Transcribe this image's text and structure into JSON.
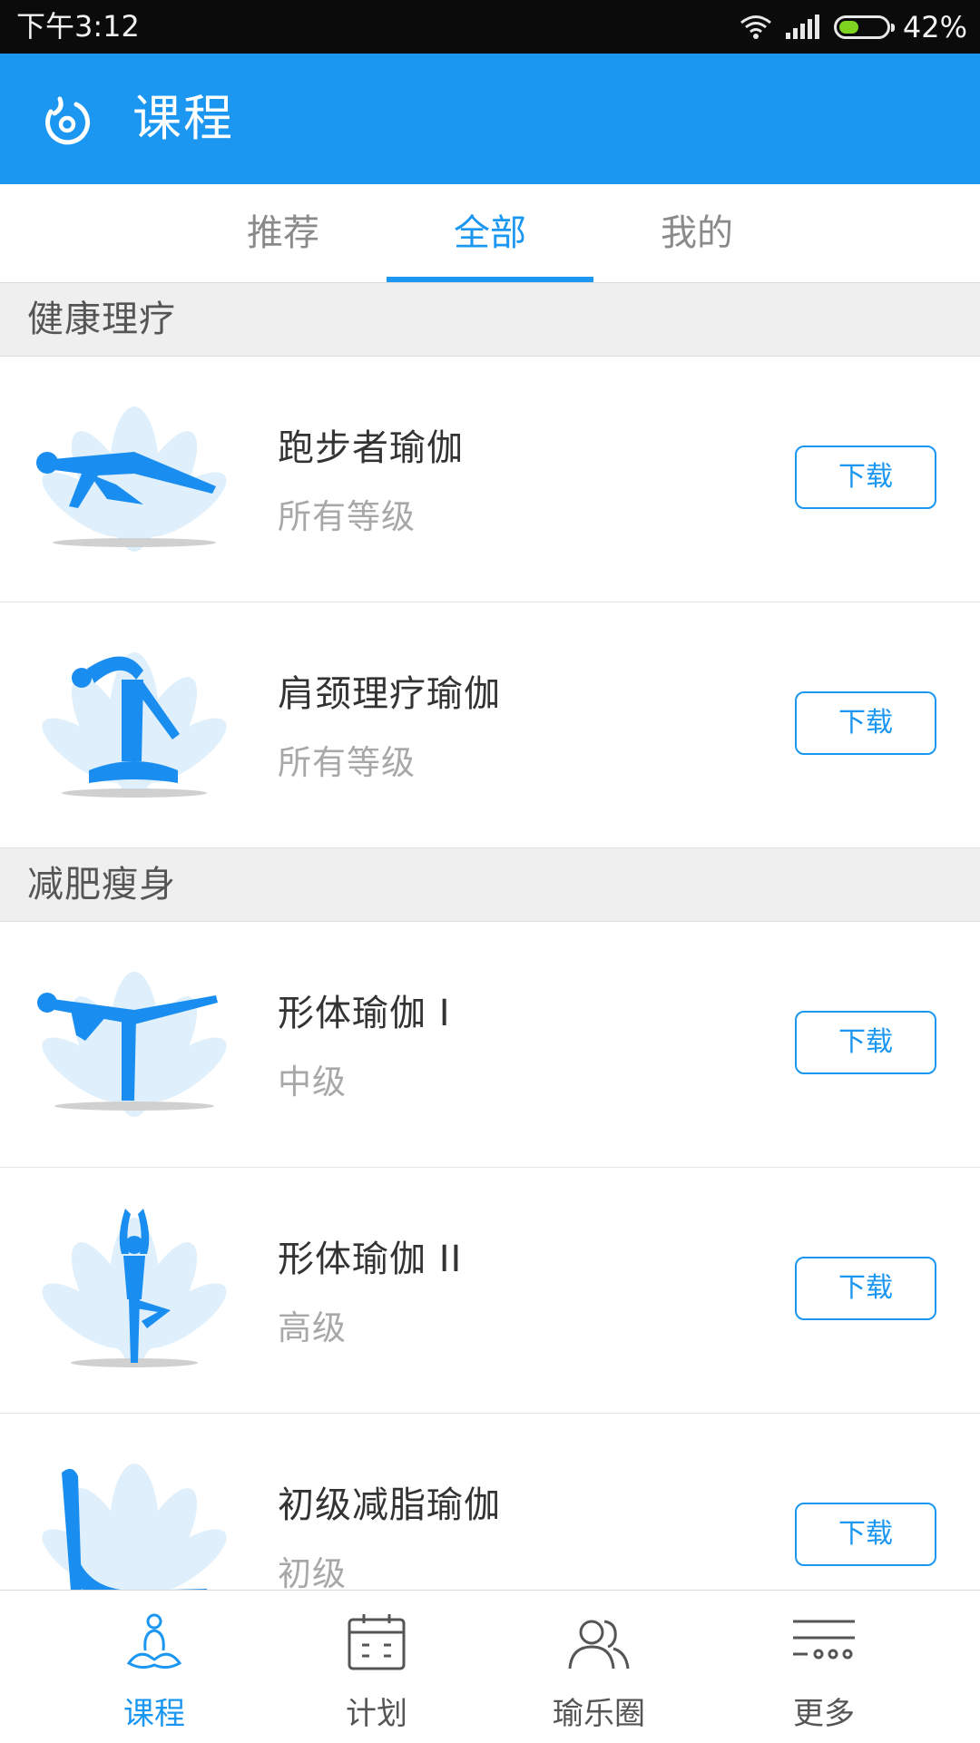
{
  "status_bar": {
    "time": "下午3:12",
    "battery_percent_text": "42%",
    "battery_level": 0.42
  },
  "app_bar": {
    "title": "课程",
    "logo_icon": "app-logo-icon"
  },
  "tabs": [
    {
      "label": "推荐",
      "active": false
    },
    {
      "label": "全部",
      "active": true
    },
    {
      "label": "我的",
      "active": false
    }
  ],
  "sections": [
    {
      "title": "健康理疗",
      "courses": [
        {
          "name": "跑步者瑜伽",
          "level": "所有等级",
          "button": "下载",
          "pose_icon": "crawl-pose-icon"
        },
        {
          "name": "肩颈理疗瑜伽",
          "level": "所有等级",
          "button": "下载",
          "pose_icon": "seated-stretch-pose-icon"
        }
      ]
    },
    {
      "title": "减肥瘦身",
      "courses": [
        {
          "name": "形体瑜伽 I",
          "level": "中级",
          "button": "下载",
          "pose_icon": "warrior-three-pose-icon"
        },
        {
          "name": "形体瑜伽 II",
          "level": "高级",
          "button": "下载",
          "pose_icon": "tree-pose-icon"
        },
        {
          "name": "初级减脂瑜伽",
          "level": "初级",
          "button": "下载",
          "pose_icon": "downward-dog-pose-icon"
        }
      ]
    }
  ],
  "bottom_nav": [
    {
      "label": "课程",
      "icon": "meditation-icon",
      "active": true
    },
    {
      "label": "计划",
      "icon": "calendar-icon",
      "active": false
    },
    {
      "label": "瑜乐圈",
      "icon": "people-icon",
      "active": false
    },
    {
      "label": "更多",
      "icon": "more-menu-icon",
      "active": false
    }
  ],
  "colors": {
    "primary": "#1b97f2",
    "section_bg": "#efefef",
    "text_primary": "#333333",
    "text_secondary": "#a8a8a8"
  }
}
